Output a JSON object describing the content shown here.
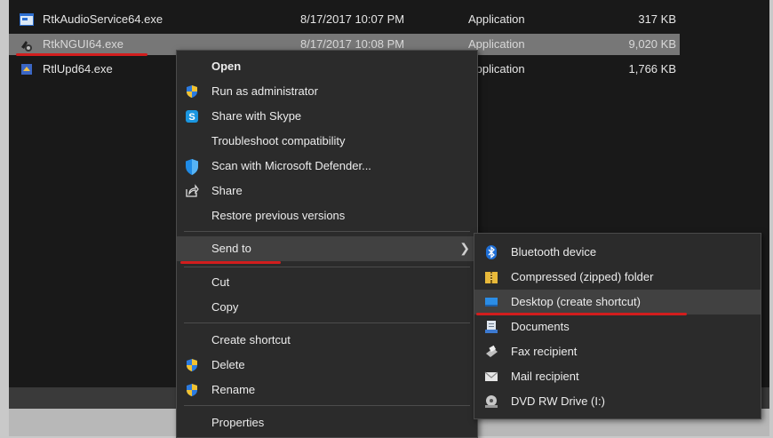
{
  "files": [
    {
      "name": "RtkAudioService64.exe",
      "date": "8/17/2017 10:07 PM",
      "type": "Application",
      "size": "317 KB",
      "icon": "app-window-icon"
    },
    {
      "name": "RtkNGUI64.exe",
      "date": "8/17/2017 10:08 PM",
      "type": "Application",
      "size": "9,020 KB",
      "icon": "speaker-app-icon"
    },
    {
      "name": "RtlUpd64.exe",
      "date": "",
      "type": "Application",
      "size": "1,766 KB",
      "icon": "updater-app-icon"
    }
  ],
  "context_menu": {
    "open": "Open",
    "run_as_admin": "Run as administrator",
    "share_skype": "Share with Skype",
    "troubleshoot": "Troubleshoot compatibility",
    "scan_defender": "Scan with Microsoft Defender...",
    "share": "Share",
    "restore_versions": "Restore previous versions",
    "send_to": "Send to",
    "cut": "Cut",
    "copy": "Copy",
    "create_shortcut": "Create shortcut",
    "delete": "Delete",
    "rename": "Rename",
    "properties": "Properties"
  },
  "send_to_menu": {
    "bluetooth": "Bluetooth device",
    "compressed": "Compressed (zipped) folder",
    "desktop": "Desktop (create shortcut)",
    "documents": "Documents",
    "fax": "Fax recipient",
    "mail": "Mail recipient",
    "dvd": "DVD RW Drive (I:)"
  },
  "colors": {
    "highlight_underline": "#d21d1d",
    "menu_bg": "#2b2b2b",
    "selection_bg": "#777777"
  }
}
